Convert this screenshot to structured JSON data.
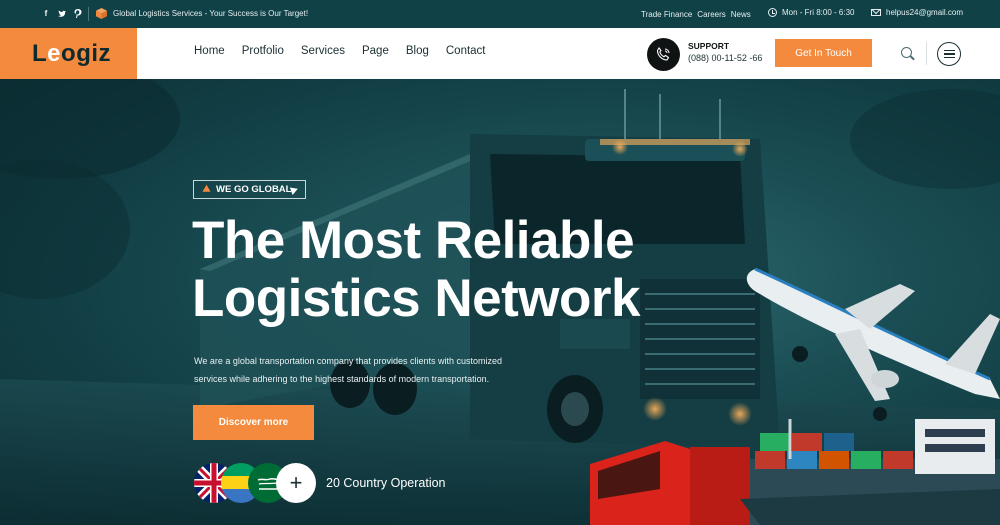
{
  "topbar": {
    "social_icons": [
      "facebook-icon",
      "twitter-icon",
      "pinterest-icon"
    ],
    "tagline": "Global Logistics Services - Your Success is Our Target!",
    "links": [
      "Trade Finance",
      "Careers",
      "News"
    ],
    "hours": "Mon - Fri 8:00 - 6:30",
    "email": "helpus24@gmail.com"
  },
  "header": {
    "logo_text_before": "L",
    "logo_text_accent": "e",
    "logo_text_after": "ogiz",
    "menu": [
      "Home",
      "Protfolio",
      "Services",
      "Page",
      "Blog",
      "Contact"
    ],
    "support_label": "SUPPORT",
    "support_phone": "(088) 00-11-52 -66",
    "cta_label": "Get In Touch"
  },
  "hero": {
    "badge": "WE GO GLOBAL",
    "heading_line1": "The Most Reliable",
    "heading_line2": "Logistics Network",
    "description": "We are a global transportation company that provides clients with customized services while adhering to the highest standards of modern transportation.",
    "discover_label": "Discover more",
    "flags": [
      "uk-flag",
      "gabon-flag",
      "saudi-flag"
    ],
    "plus_label": "+",
    "country_text": "20 Country Operation"
  },
  "colors": {
    "accent": "#f48a3d",
    "topbar": "#0f4147",
    "hero_dark": "#0d3a40"
  }
}
